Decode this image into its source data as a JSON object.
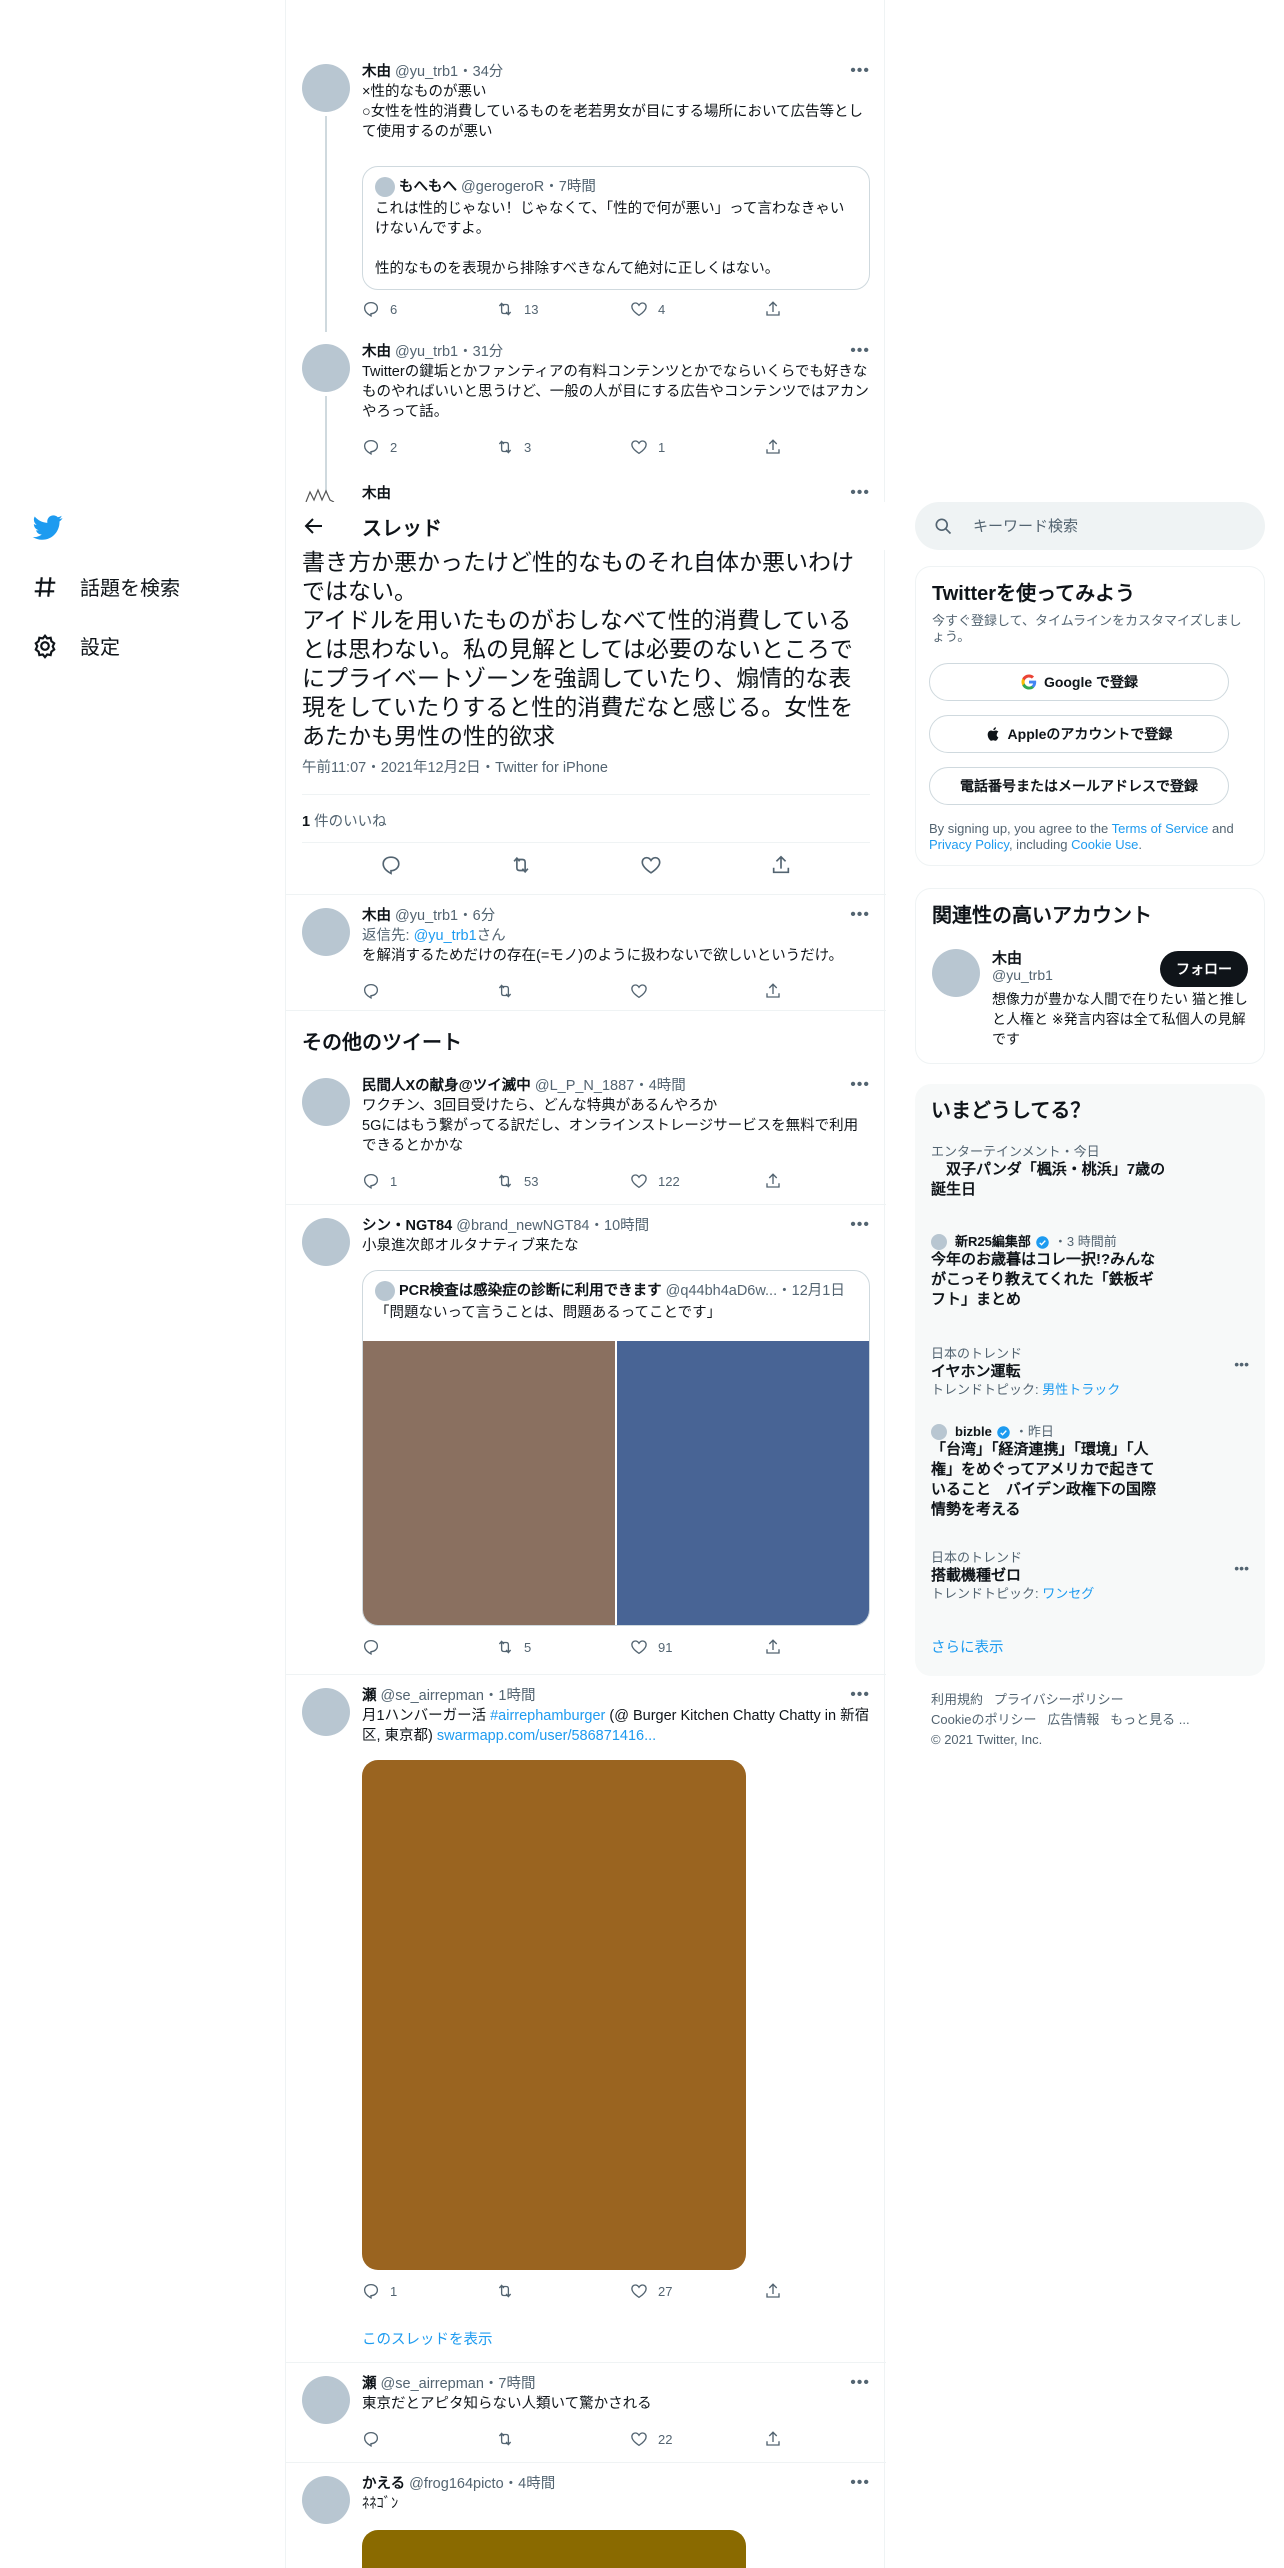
{
  "nav": {
    "explore": "話題を検索",
    "settings": "設定"
  },
  "thread_header": {
    "title": "スレッド"
  },
  "tweets_top": [
    {
      "name": "木由",
      "handle": "@yu_trb1",
      "time": "・34分",
      "text": "×性的なものが悪い\n○女性を性的消費しているものを老若男女が目にする場所において広告等として使用するのが悪い",
      "quote": {
        "name": "もへもへ",
        "handle": "@gerogeroR",
        "time": "・7時間",
        "text": "これは性的じゃない！じゃなくて、「性的で何が悪い」って言わなきゃいけないんですよ。\n\n性的なものを表現から排除すべきなんて絶対に正しくはない。"
      },
      "stats": {
        "reply": "6",
        "retweet": "13",
        "like": "4"
      }
    },
    {
      "name": "木由",
      "handle": "@yu_trb1",
      "time": "・31分",
      "text": "Twitterの鍵垢とかファンティアの有料コンテンツとかでならいくらでも好きなものやればいいと思うけど、一般の人が目にする広告やコンテンツではアカンやろって話。",
      "stats": {
        "reply": "2",
        "retweet": "3",
        "like": "1"
      }
    }
  ],
  "focus": {
    "name": "木由",
    "text": "書き方か悪かったけど性的なものそれ自体か悪いわけではない。\nアイドルを用いたものがおしなべて性的消費しているとは思わない。私の見解としては必要のないところでにプライベートゾーンを強調していたり、煽情的な表現をしていたりすると性的消費だなと感じる。女性をあたかも男性の性的欲求",
    "meta": "午前11:07・2021年12月2日・Twitter for iPhone",
    "likes_count": "1",
    "likes_label": " 件のいいね"
  },
  "reply": {
    "name": "木由",
    "handle": "@yu_trb1",
    "time": "・6分",
    "reply_to_prefix": "返信先: ",
    "reply_to": "@yu_trb1",
    "reply_to_suffix": "さん",
    "text": "を解消するためだけの存在(=モノ)のように扱わないで欲しいというだけ。"
  },
  "more_tweets_heading": "その他のツイート",
  "more_tweets": [
    {
      "name": "民間人Xの献身@ツイ滅中",
      "handle": "@L_P_N_1887",
      "time": "・4時間",
      "text": "ワクチン、3回目受けたら、どんな特典があるんやろか\n5Gにはもう繋がってる訳だし、オンラインストレージサービスを無料で利用できるとかかな",
      "stats": {
        "reply": "1",
        "retweet": "53",
        "like": "122"
      }
    },
    {
      "name": "シン・NGT84",
      "handle": "@brand_newNGT84",
      "time": "・10時間",
      "text": "小泉進次郎オルタナティブ来たな",
      "quote": {
        "name": "PCR検査は感染症の診断に利用できます",
        "handle": "@q44bh4aD6w...",
        "time": "・12月1日",
        "text": "「問題ないって言うことは、問題あるってことです」"
      },
      "stats": {
        "reply": "",
        "retweet": "5",
        "like": "91"
      }
    },
    {
      "name": "瀬",
      "handle": "@se_airrepman",
      "time": "・1時間",
      "text_prefix": "月1ハンバーガー活 ",
      "hashtag": "#airrephamburger",
      "text_mid": " (@ Burger Kitchen Chatty Chatty in 新宿区, 東京都) ",
      "link": "swarmapp.com/user/586871416...",
      "stats": {
        "reply": "1",
        "retweet": "",
        "like": "27"
      },
      "show_thread": "このスレッドを表示"
    },
    {
      "name": "瀬",
      "handle": "@se_airrepman",
      "time": "・7時間",
      "text": "東京だとアピタ知らない人類いて驚かされる",
      "stats": {
        "reply": "",
        "retweet": "",
        "like": "22"
      }
    },
    {
      "name": "かえる",
      "handle": "@frog164picto",
      "time": "・4時間",
      "text": "ﾈﾈｺﾞﾝ"
    }
  ],
  "search": {
    "placeholder": "キーワード検索"
  },
  "signup": {
    "title": "Twitterを使ってみよう",
    "subtitle": "今すぐ登録して、タイムラインをカスタマイズしましょう。",
    "google": "Google で登録",
    "apple": "Appleのアカウントで登録",
    "phone": "電話番号またはメールアドレスで登録",
    "legal_prefix": "By signing up, you agree to the ",
    "terms": "Terms of Service",
    "and": " and ",
    "privacy": "Privacy Policy",
    "including": ", including ",
    "cookie": "Cookie Use",
    "period": "."
  },
  "related": {
    "title": "関連性の高いアカウント",
    "name": "木由",
    "handle": "@yu_trb1",
    "follow": "フォロー",
    "bio": "想像力が豊かな人間で在りたい 猫と推しと人権と ※発言内容は全て私個人の見解です"
  },
  "trends": {
    "title": "いまどうしてる？",
    "items": [
      {
        "meta": "エンターテインメント・今日",
        "name": "　双子パンダ「楓浜・桃浜」7歳の誕生日"
      },
      {
        "source": "新R25編集部",
        "time": "・3 時間前",
        "name": "今年のお歳暮はコレ一択!?みんながこっそり教えてくれた「鉄板ギフト」まとめ"
      },
      {
        "meta": "日本のトレンド",
        "name": "イヤホン運転",
        "topic_label": "トレンドトピック: ",
        "topic": "男性トラック"
      },
      {
        "source": "bizble",
        "time": "・昨日",
        "name": "「台湾」「経済連携」「環境」「人権」をめぐってアメリカで起きていること　バイデン政権下の国際情勢を考える"
      },
      {
        "meta": "日本のトレンド",
        "name": "搭載機種ゼロ",
        "topic_label": "トレンドトピック: ",
        "topic": "ワンセグ"
      }
    ],
    "show_more": "さらに表示"
  },
  "footer": {
    "terms": "利用規約",
    "privacy": "プライバシーポリシー",
    "cookie": "Cookieのポリシー",
    "ads": "広告情報",
    "more": "もっと見る ...",
    "copyright": "© 2021 Twitter, Inc."
  },
  "colors": {
    "accent": "#1d9bf0",
    "verified": "#1d9bf0",
    "image1": "#8a7060",
    "image2": "#486495",
    "image3": "#9a6420",
    "image4": "#8a6a00"
  }
}
